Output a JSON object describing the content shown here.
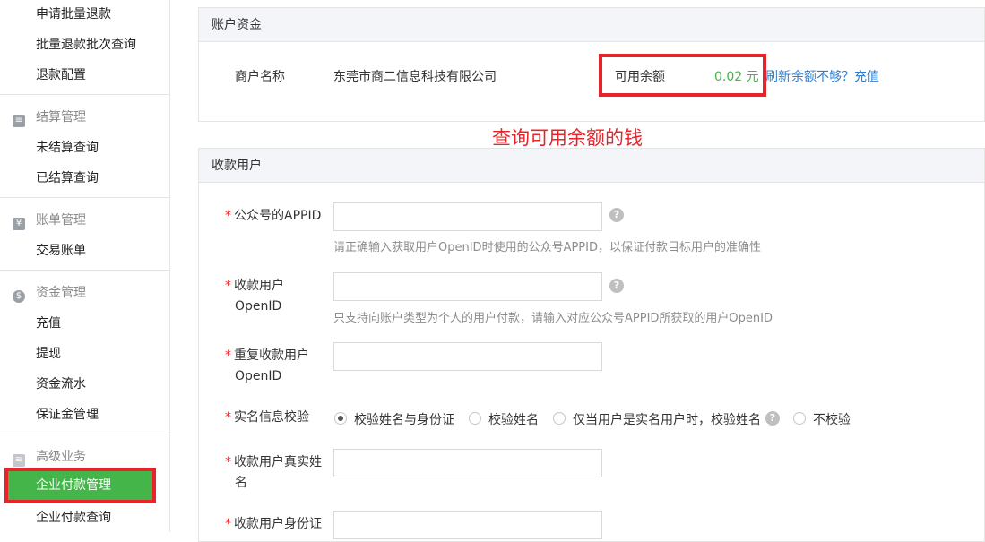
{
  "sidebar": {
    "top_items": [
      "申请批量退款",
      "批量退款批次查询",
      "退款配置"
    ],
    "groups": [
      {
        "title": "结算管理",
        "icon": "settlement-icon",
        "items": [
          "未结算查询",
          "已结算查询"
        ]
      },
      {
        "title": "账单管理",
        "icon": "yen-icon",
        "items": [
          "交易账单"
        ]
      },
      {
        "title": "资金管理",
        "icon": "money-bag-icon",
        "items": [
          "充值",
          "提现",
          "资金流水",
          "保证金管理"
        ]
      },
      {
        "title": "高级业务",
        "icon": "layers-icon",
        "items": [
          "企业付款管理",
          "企业付款查询"
        ]
      }
    ],
    "active_item": "企业付款管理"
  },
  "account_panel": {
    "title": "账户资金",
    "merchant_label": "商户名称",
    "merchant_name": "东莞市商二信息科技有限公司",
    "balance_label": "可用余额",
    "balance_value": "0.02 元",
    "refresh_link": "刷新",
    "recharge_link": "余额不够？充值"
  },
  "annotation": "查询可用余额的钱",
  "payee_panel": {
    "title": "收款用户",
    "fields": {
      "appid_label": "公众号的APPID",
      "appid_hint": "请正确输入获取用户OpenID时使用的公众号APPID，以保证付款目标用户的准确性",
      "openid_label_1": "收款用户",
      "openid_label_2": "OpenID",
      "openid_hint": "只支持向账户类型为个人的用户付款，请输入对应公众号APPID所获取的用户OpenID",
      "repeat_label_1": "重复收款用户",
      "repeat_label_2": "OpenID",
      "verify_label": "实名信息校验",
      "verify_options": [
        "校验姓名与身份证",
        "校验姓名",
        "仅当用户是实名用户时，校验姓名",
        "不校验"
      ],
      "realname_label_1": "收款用户真实姓",
      "realname_label_2": "名",
      "idcard_label": "收款用户身份证"
    }
  },
  "colors": {
    "accent_green": "#44b549",
    "annotation_red": "#e8242a",
    "link_blue": "#2a7fd4",
    "balance_green": "#44b549"
  }
}
